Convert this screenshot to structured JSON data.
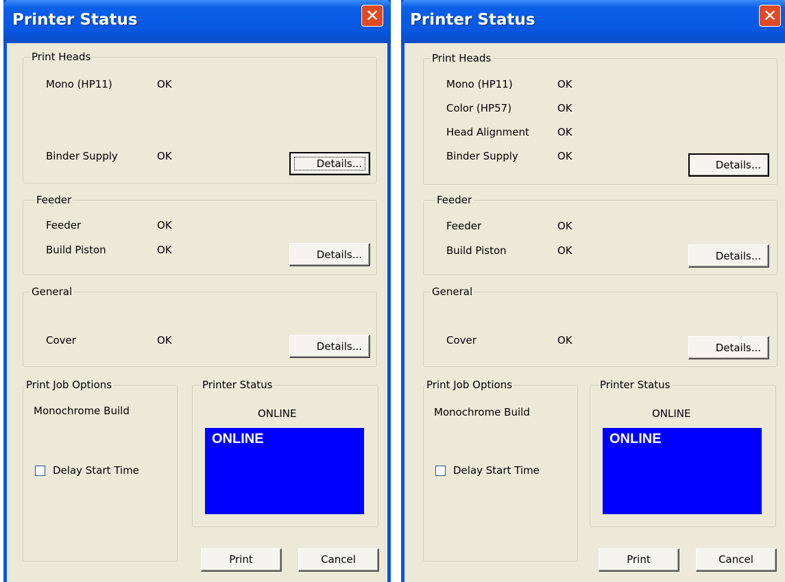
{
  "left": {
    "title": "Printer Status",
    "close_glyph": "✕",
    "print_heads": {
      "label": "Print Heads",
      "rows": [
        {
          "name": "Mono (HP11)",
          "status": "OK"
        },
        {
          "name": "Binder Supply",
          "status": "OK"
        }
      ],
      "details_label": "Details..."
    },
    "feeder": {
      "label": "Feeder",
      "rows": [
        {
          "name": "Feeder",
          "status": "OK"
        },
        {
          "name": "Build Piston",
          "status": "OK"
        }
      ],
      "details_label": "Details..."
    },
    "general": {
      "label": "General",
      "rows": [
        {
          "name": "Cover",
          "status": "OK"
        }
      ],
      "details_label": "Details..."
    },
    "job_options": {
      "label": "Print Job Options",
      "mode": "Monochrome Build",
      "delay_label": "Delay Start Time"
    },
    "printer_status": {
      "label": "Printer Status",
      "state": "ONLINE",
      "display": "ONLINE"
    },
    "print_label": "Print",
    "cancel_label": "Cancel"
  },
  "right": {
    "title": "Printer Status",
    "close_glyph": "✕",
    "print_heads": {
      "label": "Print Heads",
      "rows": [
        {
          "name": "Mono (HP11)",
          "status": "OK"
        },
        {
          "name": "Color (HP57)",
          "status": "OK"
        },
        {
          "name": "Head Alignment",
          "status": "OK"
        },
        {
          "name": "Binder Supply",
          "status": "OK"
        }
      ],
      "details_label": "Details..."
    },
    "feeder": {
      "label": "Feeder",
      "rows": [
        {
          "name": "Feeder",
          "status": "OK"
        },
        {
          "name": "Build Piston",
          "status": "OK"
        }
      ],
      "details_label": "Details..."
    },
    "general": {
      "label": "General",
      "rows": [
        {
          "name": "Cover",
          "status": "OK"
        }
      ],
      "details_label": "Details..."
    },
    "job_options": {
      "label": "Print Job Options",
      "mode": "Monochrome Build",
      "delay_label": "Delay Start Time"
    },
    "printer_status": {
      "label": "Printer Status",
      "state": "ONLINE",
      "display": "ONLINE"
    },
    "print_label": "Print",
    "cancel_label": "Cancel"
  },
  "colors": {
    "titlebar": "#0857e0",
    "dialog_bg": "#ece9d8",
    "status_display": "#0000ff",
    "close_button": "#e04b24"
  },
  "icons": {
    "close": "close-icon",
    "checkbox": "checkbox-icon"
  }
}
